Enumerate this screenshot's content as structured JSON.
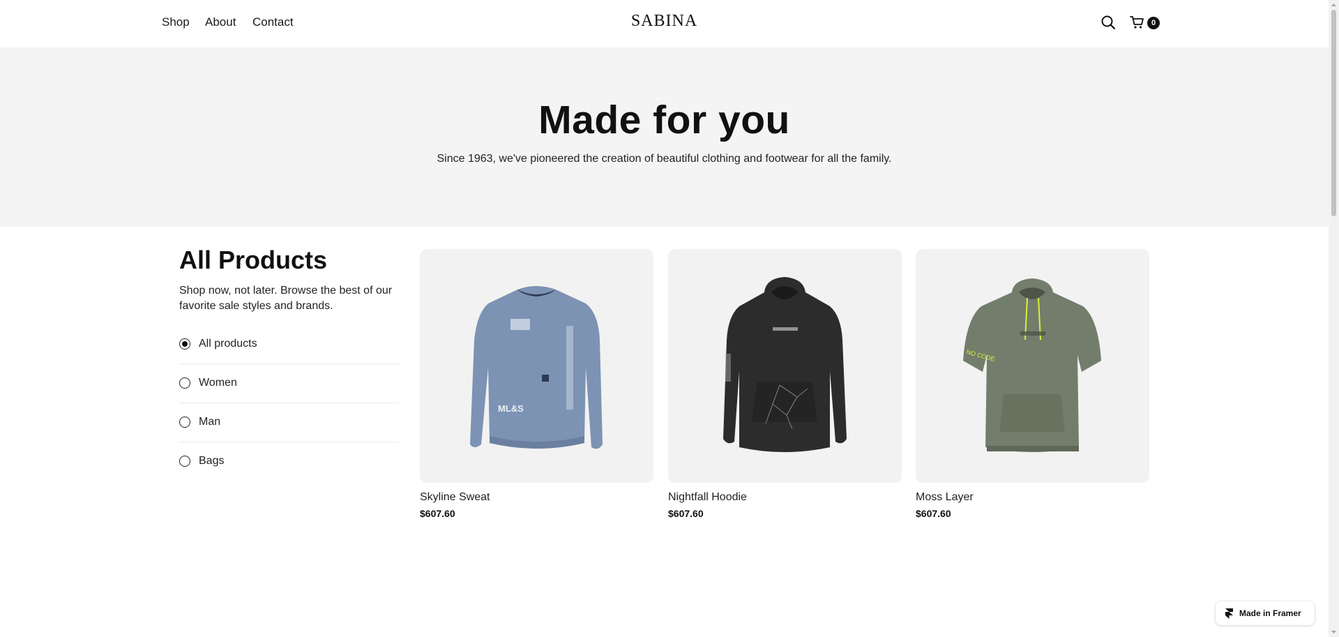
{
  "header": {
    "nav": [
      "Shop",
      "About",
      "Contact"
    ],
    "logo": "SABINA",
    "icons": [
      "search-icon",
      "cart-icon"
    ],
    "cart_count": "0"
  },
  "hero": {
    "title": "Made for you",
    "subtitle": "Since 1963, we've pioneered the creation of beautiful clothing and footwear for all the family."
  },
  "sidebar": {
    "title": "All Products",
    "description": "Shop now, not later. Browse the best of our favorite sale styles and brands.",
    "filters": [
      {
        "label": "All products",
        "selected": true
      },
      {
        "label": "Women",
        "selected": false
      },
      {
        "label": "Man",
        "selected": false
      },
      {
        "label": "Bags",
        "selected": false
      }
    ]
  },
  "products": [
    {
      "name": "Skyline Sweat",
      "price": "$607.60",
      "color": "#7d93b4",
      "image": "sweatshirt"
    },
    {
      "name": "Nightfall Hoodie",
      "price": "$607.60",
      "color": "#2c2c2c",
      "image": "hoodie"
    },
    {
      "name": "Moss Layer",
      "price": "$607.60",
      "color": "#737d6c",
      "image": "short-sleeve-hoodie"
    }
  ],
  "badge": {
    "label": "Made in Framer"
  },
  "colors": {
    "hero_bg": "#f4f4f4",
    "card_bg": "#f2f2f2",
    "text": "#111111"
  }
}
